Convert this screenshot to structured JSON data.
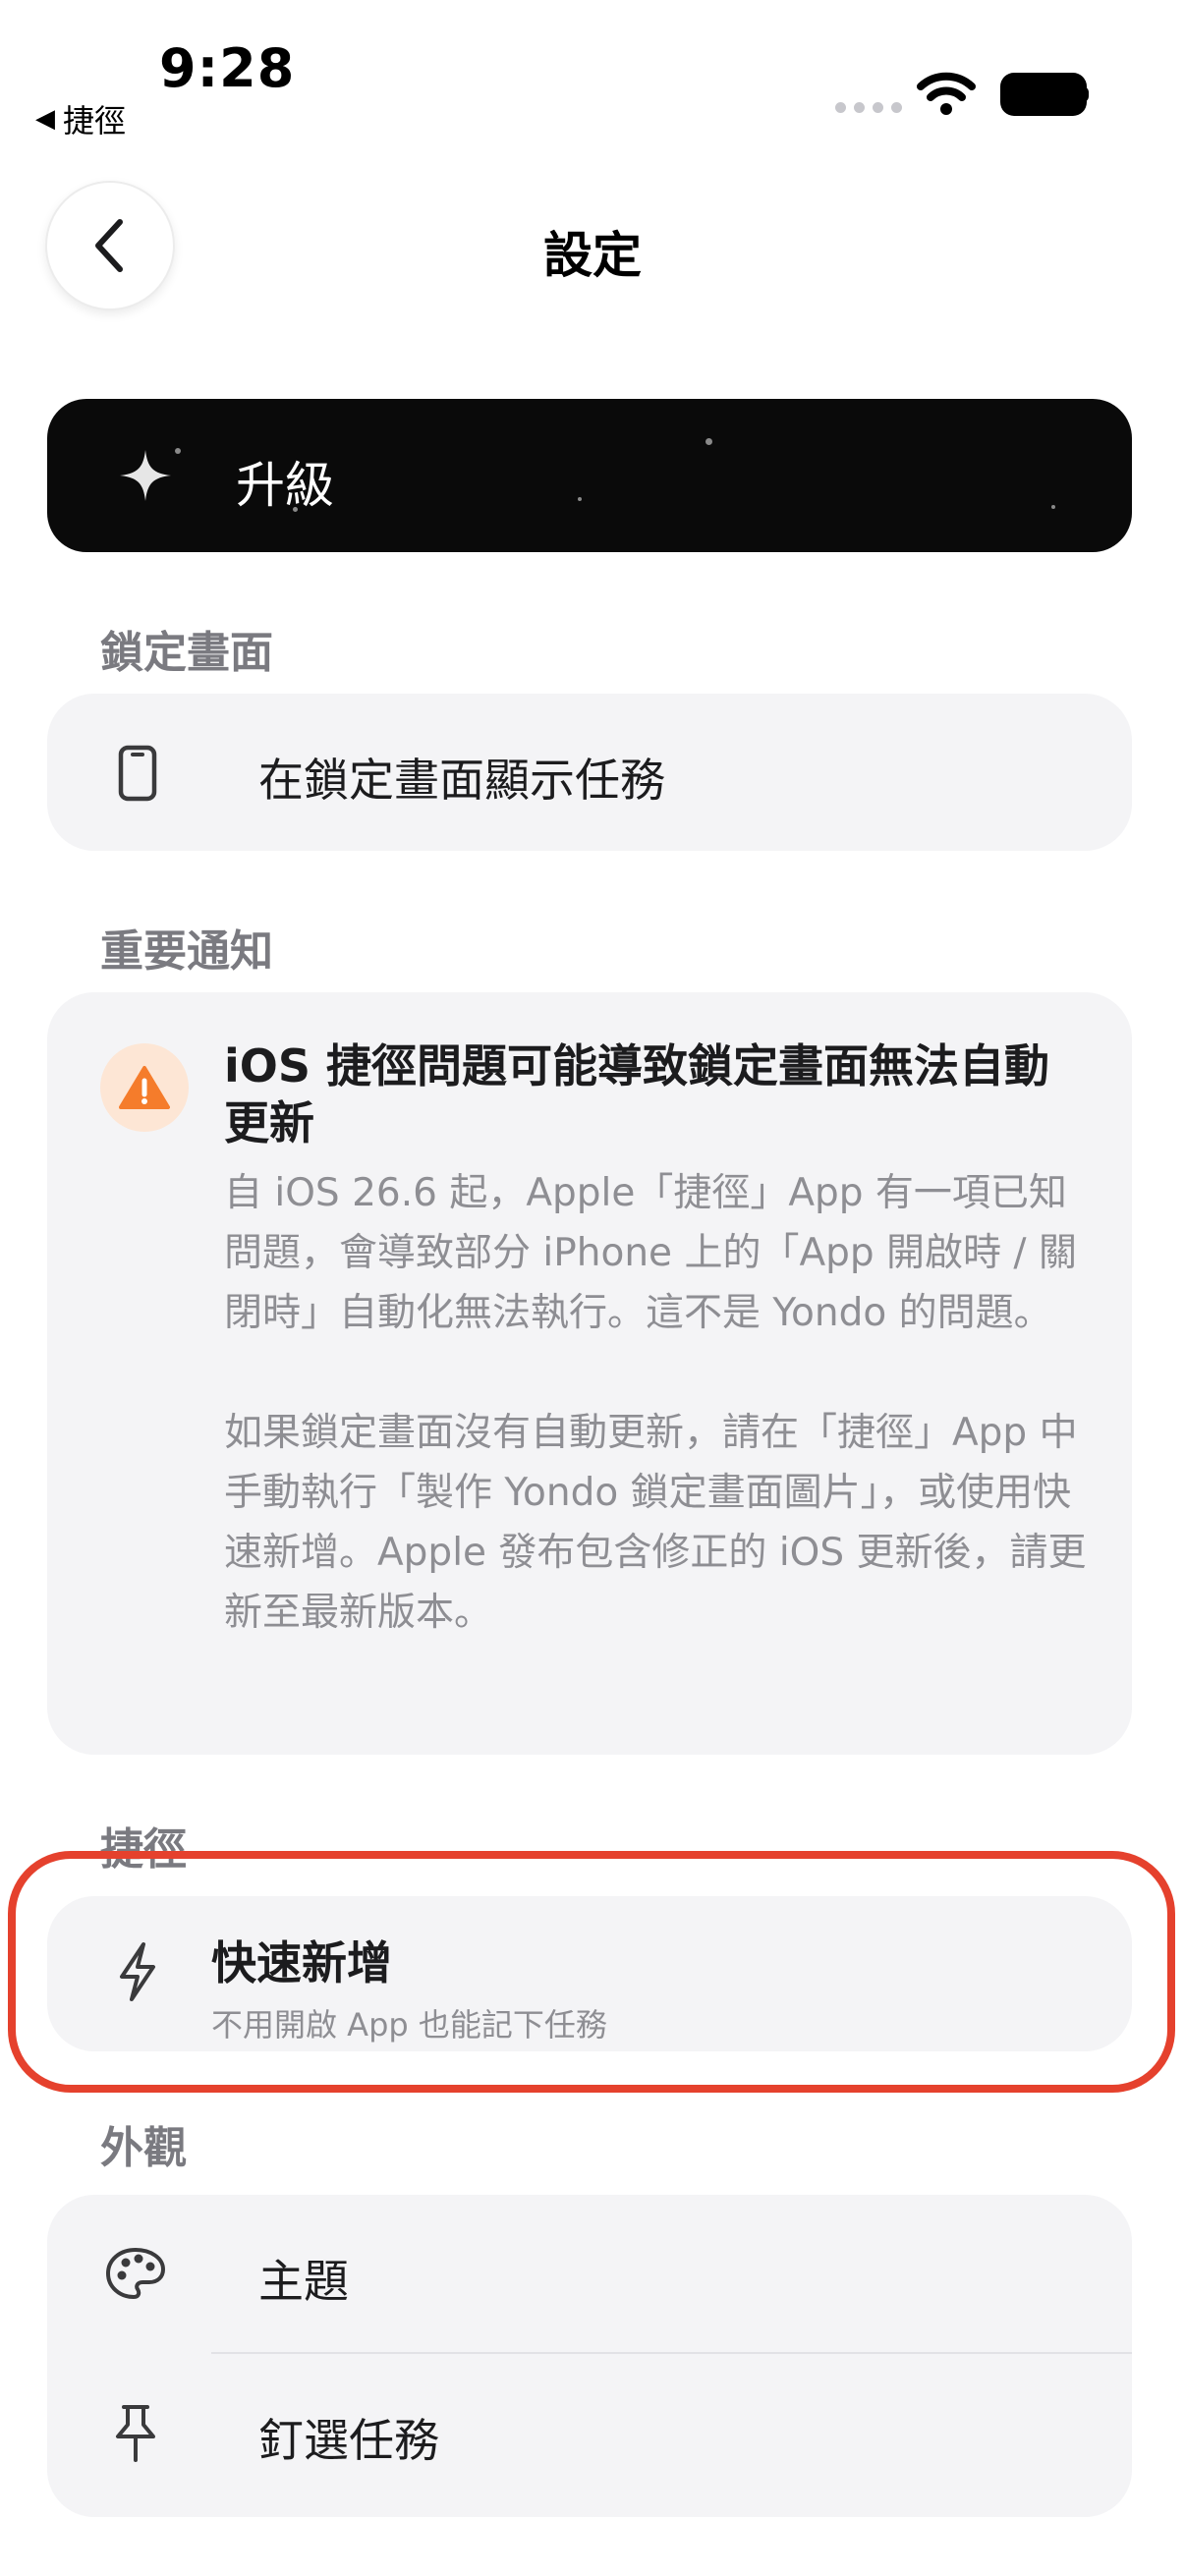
{
  "status_bar": {
    "time": "9:28",
    "back_app": "捷徑",
    "back_arrow": "◀"
  },
  "nav": {
    "title": "設定",
    "back_icon": "chevron-left-icon"
  },
  "upgrade": {
    "label": "升級",
    "icon": "sparkle-icon"
  },
  "sections": {
    "lock_screen": {
      "header": "鎖定畫面",
      "item_label": "在鎖定畫面顯示任務",
      "item_icon": "phone-icon"
    },
    "notice": {
      "header": "重要通知",
      "title": "iOS 捷徑問題可能導致鎖定畫面無法自動更新",
      "body_1": "自 iOS 26.6 起，Apple「捷徑」App 有一項已知問題，會導致部分 iPhone 上的「App 開啟時 / 關閉時」自動化無法執行。這不是 Yondo 的問題。",
      "body_2": "如果鎖定畫面沒有自動更新，請在「捷徑」App 中手動執行「製作 Yondo 鎖定畫面圖片」，或使用快速新增。Apple 發布包含修正的 iOS 更新後，請更新至最新版本。",
      "icon": "warning-icon",
      "accent": "#f57c2b"
    },
    "shortcuts": {
      "header": "捷徑",
      "item_title": "快速新增",
      "item_subtitle": "不用開啟 App 也能記下任務",
      "item_icon": "bolt-icon",
      "highlight_color": "#e5412d"
    },
    "appearance": {
      "header": "外觀",
      "items": [
        {
          "label": "主題",
          "icon": "palette-icon"
        },
        {
          "label": "釘選任務",
          "icon": "pin-icon"
        }
      ]
    }
  }
}
